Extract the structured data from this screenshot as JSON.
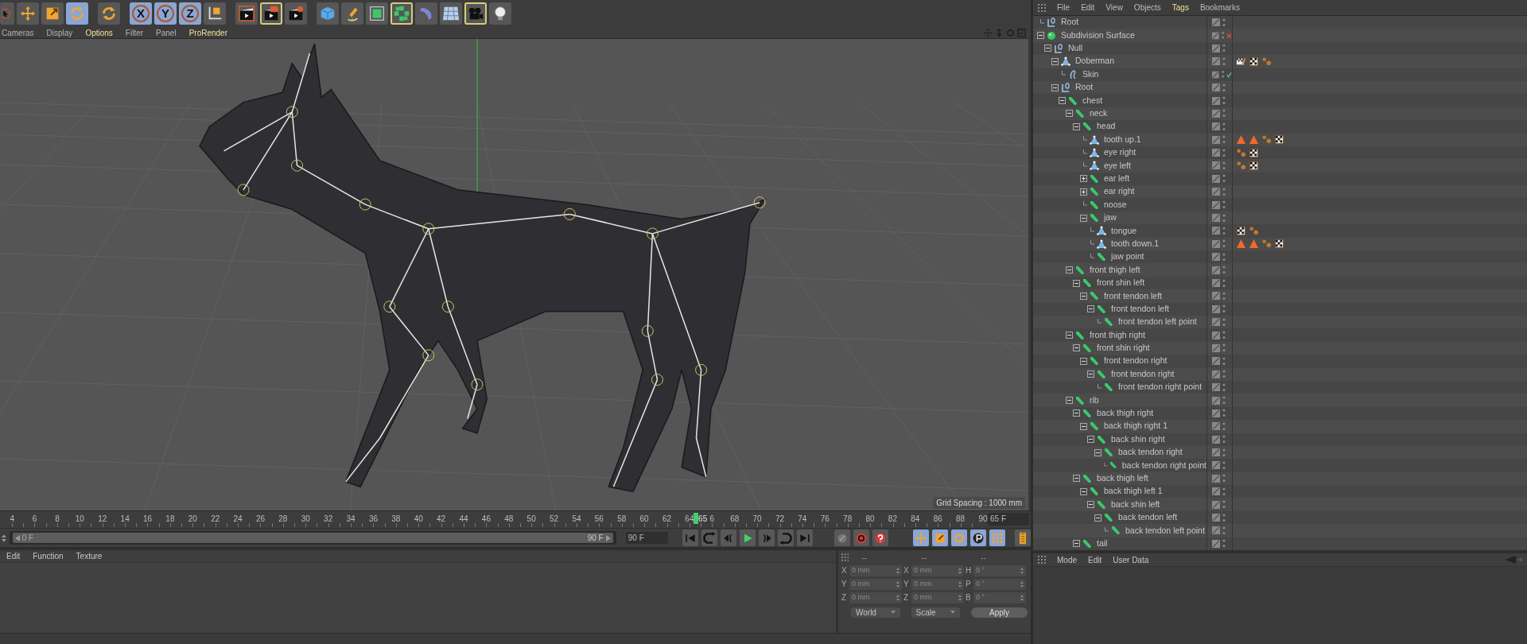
{
  "toolbar": [
    {
      "kind": "pointer",
      "selected": false,
      "active": false
    },
    {
      "kind": "move",
      "selected": false,
      "active": false
    },
    {
      "kind": "scale",
      "selected": false,
      "active": false
    },
    {
      "kind": "rotate",
      "selected": true,
      "active": false
    },
    {
      "kind": "recent",
      "selected": false,
      "active": false
    },
    {
      "kind": "axis",
      "label": "X",
      "selected": true,
      "active": false
    },
    {
      "kind": "axis",
      "label": "Y",
      "selected": true,
      "active": false
    },
    {
      "kind": "axis",
      "label": "Z",
      "selected": true,
      "active": false
    },
    {
      "kind": "coordinates",
      "selected": false,
      "active": false
    },
    {
      "kind": "render-view",
      "selected": false,
      "active": false
    },
    {
      "kind": "render",
      "selected": false,
      "active": true
    },
    {
      "kind": "render-settings",
      "selected": false,
      "active": false
    },
    {
      "kind": "cube",
      "selected": false,
      "active": false
    },
    {
      "kind": "pen",
      "selected": false,
      "active": false
    },
    {
      "kind": "subdivision",
      "selected": false,
      "active": false
    },
    {
      "kind": "array",
      "selected": false,
      "active": true
    },
    {
      "kind": "deformer",
      "selected": false,
      "active": false
    },
    {
      "kind": "floor",
      "selected": false,
      "active": false
    },
    {
      "kind": "camera",
      "selected": false,
      "active": true
    },
    {
      "kind": "light",
      "selected": false,
      "active": false
    }
  ],
  "viewport": {
    "menu": [
      {
        "label": "Cameras",
        "highlighted": false
      },
      {
        "label": "Display",
        "highlighted": false
      },
      {
        "label": "Options",
        "highlighted": true
      },
      {
        "label": "Filter",
        "highlighted": false
      },
      {
        "label": "Panel",
        "highlighted": false
      },
      {
        "label": "ProRender",
        "highlighted": true
      }
    ],
    "grid_spacing": "Grid Spacing : 1000 mm"
  },
  "timeline": {
    "frames": [
      {
        "label": "4",
        "selected": false
      },
      {
        "label": "6",
        "selected": false
      },
      {
        "label": "8",
        "selected": false
      },
      {
        "label": "10",
        "selected": false
      },
      {
        "label": "12",
        "selected": false
      },
      {
        "label": "14",
        "selected": false
      },
      {
        "label": "16",
        "selected": false
      },
      {
        "label": "18",
        "selected": false
      },
      {
        "label": "20",
        "selected": false
      },
      {
        "label": "22",
        "selected": false
      },
      {
        "label": "24",
        "selected": false
      },
      {
        "label": "26",
        "selected": false
      },
      {
        "label": "28",
        "selected": false
      },
      {
        "label": "30",
        "selected": false
      },
      {
        "label": "32",
        "selected": false
      },
      {
        "label": "34",
        "selected": false
      },
      {
        "label": "36",
        "selected": false
      },
      {
        "label": "38",
        "selected": false
      },
      {
        "label": "40",
        "selected": false
      },
      {
        "label": "42",
        "selected": false
      },
      {
        "label": "44",
        "selected": false
      },
      {
        "label": "46",
        "selected": false
      },
      {
        "label": "48",
        "selected": false
      },
      {
        "label": "50",
        "selected": false
      },
      {
        "label": "52",
        "selected": false
      },
      {
        "label": "54",
        "selected": false
      },
      {
        "label": "56",
        "selected": false
      },
      {
        "label": "58",
        "selected": false
      },
      {
        "label": "60",
        "selected": false
      },
      {
        "label": "62",
        "selected": false
      },
      {
        "label": "64",
        "selected": false
      },
      {
        "label": "65",
        "selected": true
      },
      {
        "label": "6",
        "selected": false
      },
      {
        "label": "68",
        "selected": false
      },
      {
        "label": "70",
        "selected": false
      },
      {
        "label": "72",
        "selected": false
      },
      {
        "label": "74",
        "selected": false
      },
      {
        "label": "76",
        "selected": false
      },
      {
        "label": "78",
        "selected": false
      },
      {
        "label": "80",
        "selected": false
      },
      {
        "label": "82",
        "selected": false
      },
      {
        "label": "84",
        "selected": false
      },
      {
        "label": "86",
        "selected": false
      },
      {
        "label": "88",
        "selected": false
      },
      {
        "label": "90",
        "selected": false
      }
    ],
    "frame_field": "65 F"
  },
  "range": {
    "start": "0 F",
    "end": "90 F",
    "end_field": "90 F",
    "level": 1
  },
  "transport": [
    {
      "kind": "start",
      "selected": false
    },
    {
      "kind": "prev-key",
      "selected": false
    },
    {
      "kind": "prev-frame",
      "selected": false
    },
    {
      "kind": "play",
      "selected": false
    },
    {
      "kind": "next-frame",
      "selected": false
    },
    {
      "kind": "next-key",
      "selected": false
    },
    {
      "kind": "end",
      "selected": false
    },
    {
      "kind": "key",
      "selected": false
    },
    {
      "kind": "record",
      "selected": false
    },
    {
      "kind": "autokey",
      "selected": false
    },
    {
      "kind": "move",
      "selected": true
    },
    {
      "kind": "scale",
      "selected": true
    },
    {
      "kind": "rotate",
      "selected": true
    },
    {
      "kind": "param",
      "selected": true
    },
    {
      "kind": "points",
      "selected": true
    },
    {
      "kind": "film",
      "selected": false
    }
  ],
  "material_manager": {
    "menu": [
      "Edit",
      "Function",
      "Texture"
    ]
  },
  "coordinates": {
    "headers": [
      "--",
      "--",
      "--"
    ],
    "rows": [
      {
        "axis": "X",
        "position": "0 mm",
        "size_axis": "X",
        "size": "0 mm",
        "rot_axis": "H",
        "rotation": "0 °"
      },
      {
        "axis": "Y",
        "position": "0 mm",
        "size_axis": "Y",
        "size": "0 mm",
        "rot_axis": "P",
        "rotation": "0 °"
      },
      {
        "axis": "Z",
        "position": "0 mm",
        "size_axis": "Z",
        "size": "0 mm",
        "rot_axis": "B",
        "rotation": "0 °"
      }
    ],
    "mode": "World",
    "size_mode": "Scale",
    "apply": "Apply"
  },
  "object_manager": {
    "menu": [
      {
        "label": "File",
        "highlighted": false
      },
      {
        "label": "Edit",
        "highlighted": false
      },
      {
        "label": "View",
        "highlighted": false
      },
      {
        "label": "Objects",
        "highlighted": false
      },
      {
        "label": "Tags",
        "highlighted": true
      },
      {
        "label": "Bookmarks",
        "highlighted": false
      }
    ],
    "objects": [
      {
        "name": "Root",
        "kind": "null"
      },
      {
        "name": "Subdivision Surface",
        "kind": "subdivision",
        "expanded": true,
        "enabled": false,
        "children": [
          {
            "name": "Null",
            "kind": "null",
            "expanded": true,
            "children": [
              {
                "name": "Doberman",
                "kind": "polygon",
                "expanded": true,
                "tags": [
                  {
                    "kind": "brush-checker"
                  },
                  {
                    "kind": "checker"
                  },
                  {
                    "kind": "dots"
                  }
                ],
                "children": [
                  {
                    "name": "Skin",
                    "kind": "skin",
                    "enabled": true
                  }
                ]
              },
              {
                "name": "Root",
                "kind": "null",
                "expanded": true,
                "children": [
                  {
                    "name": "chest",
                    "kind": "joint",
                    "expanded": true,
                    "children": [
                      {
                        "name": "neck",
                        "kind": "joint",
                        "expanded": true,
                        "children": [
                          {
                            "name": "head",
                            "kind": "joint",
                            "expanded": true,
                            "children": [
                              {
                                "name": "tooth up.1",
                                "kind": "polygon",
                                "tags": [
                                  {
                                    "kind": "triangle"
                                  },
                                  {
                                    "kind": "triangle"
                                  },
                                  {
                                    "kind": "dots"
                                  },
                                  {
                                    "kind": "checker"
                                  }
                                ]
                              },
                              {
                                "name": "eye right",
                                "kind": "polygon",
                                "tags": [
                                  {
                                    "kind": "dots"
                                  },
                                  {
                                    "kind": "checker"
                                  }
                                ]
                              },
                              {
                                "name": "eye left",
                                "kind": "polygon",
                                "tags": [
                                  {
                                    "kind": "dots"
                                  },
                                  {
                                    "kind": "checker"
                                  }
                                ]
                              },
                              {
                                "name": "ear left",
                                "kind": "joint",
                                "expanded": false
                              },
                              {
                                "name": "ear right",
                                "kind": "joint",
                                "expanded": false
                              },
                              {
                                "name": "noose",
                                "kind": "joint"
                              },
                              {
                                "name": "jaw",
                                "kind": "joint",
                                "expanded": true,
                                "children": [
                                  {
                                    "name": "tongue",
                                    "kind": "polygon",
                                    "tags": [
                                      {
                                        "kind": "checker"
                                      },
                                      {
                                        "kind": "dots"
                                      }
                                    ]
                                  },
                                  {
                                    "name": "tooth down.1",
                                    "kind": "polygon",
                                    "tags": [
                                      {
                                        "kind": "triangle"
                                      },
                                      {
                                        "kind": "triangle"
                                      },
                                      {
                                        "kind": "dots"
                                      },
                                      {
                                        "kind": "checker"
                                      }
                                    ]
                                  },
                                  {
                                    "name": "jaw point",
                                    "kind": "joint"
                                  }
                                ]
                              }
                            ]
                          }
                        ]
                      },
                      {
                        "name": "front thigh left",
                        "kind": "joint",
                        "expanded": true,
                        "children": [
                          {
                            "name": "front shin left",
                            "kind": "joint",
                            "expanded": true,
                            "children": [
                              {
                                "name": "front tendon left",
                                "kind": "joint",
                                "expanded": true,
                                "children": [
                                  {
                                    "name": "front tendon left",
                                    "kind": "joint",
                                    "expanded": true,
                                    "children": [
                                      {
                                        "name": "front tendon left point",
                                        "kind": "joint"
                                      }
                                    ]
                                  }
                                ]
                              }
                            ]
                          }
                        ]
                      },
                      {
                        "name": "front thigh right",
                        "kind": "joint",
                        "expanded": true,
                        "children": [
                          {
                            "name": "front shin right",
                            "kind": "joint",
                            "expanded": true,
                            "children": [
                              {
                                "name": "front tendon right",
                                "kind": "joint",
                                "expanded": true,
                                "children": [
                                  {
                                    "name": "front tendon right",
                                    "kind": "joint",
                                    "expanded": true,
                                    "children": [
                                      {
                                        "name": "front tendon right point",
                                        "kind": "joint"
                                      }
                                    ]
                                  }
                                ]
                              }
                            ]
                          }
                        ]
                      },
                      {
                        "name": "rib",
                        "kind": "joint",
                        "expanded": true,
                        "children": [
                          {
                            "name": "back thigh right",
                            "kind": "joint",
                            "expanded": true,
                            "children": [
                              {
                                "name": "back thigh right 1",
                                "kind": "joint",
                                "expanded": true,
                                "children": [
                                  {
                                    "name": "back shin right",
                                    "kind": "joint",
                                    "expanded": true,
                                    "children": [
                                      {
                                        "name": "back tendon right",
                                        "kind": "joint",
                                        "expanded": true,
                                        "children": [
                                          {
                                            "name": "back tendon right point",
                                            "kind": "joint"
                                          }
                                        ]
                                      }
                                    ]
                                  }
                                ]
                              }
                            ]
                          },
                          {
                            "name": "back thigh left",
                            "kind": "joint",
                            "expanded": true,
                            "children": [
                              {
                                "name": "back thigh left 1",
                                "kind": "joint",
                                "expanded": true,
                                "children": [
                                  {
                                    "name": "back shin left",
                                    "kind": "joint",
                                    "expanded": true,
                                    "children": [
                                      {
                                        "name": "back tendon left",
                                        "kind": "joint",
                                        "expanded": true,
                                        "children": [
                                          {
                                            "name": "back tendon left point",
                                            "kind": "joint"
                                          }
                                        ]
                                      }
                                    ]
                                  }
                                ]
                              }
                            ]
                          },
                          {
                            "name": "tail",
                            "kind": "joint",
                            "expanded": true
                          }
                        ]
                      }
                    ]
                  }
                ]
              }
            ]
          }
        ]
      }
    ]
  },
  "attribute_manager": {
    "menu": [
      "Mode",
      "Edit",
      "User Data"
    ]
  }
}
